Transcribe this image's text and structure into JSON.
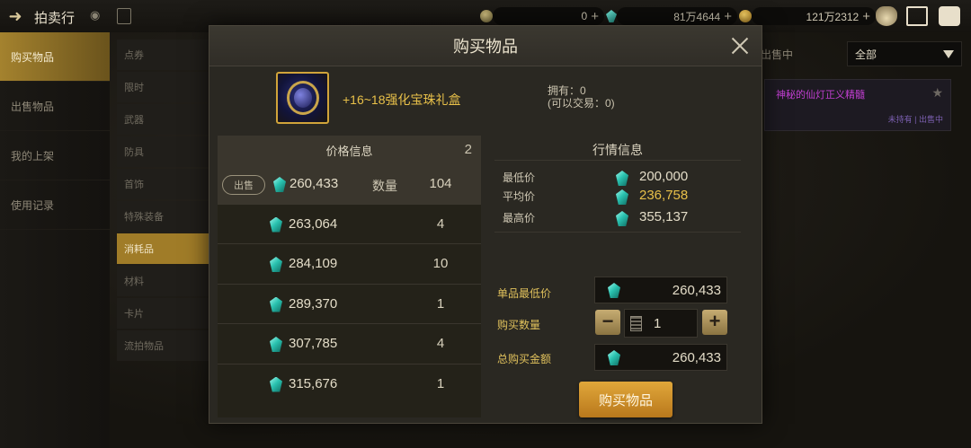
{
  "topbar": {
    "title": "拍卖行",
    "currencies": [
      {
        "icon": "moon-coin-icon",
        "value": "0"
      },
      {
        "icon": "gem-icon",
        "value": "81万4644"
      },
      {
        "icon": "gold-coin-icon",
        "value": "121万2312"
      }
    ]
  },
  "nav": {
    "items": [
      "购买物品",
      "出售物品",
      "我的上架",
      "使用记录"
    ],
    "active": 0
  },
  "categories": {
    "items": [
      "点券",
      "限时",
      "武器",
      "防具",
      "首饰",
      "特殊装备",
      "消耗品",
      "材料",
      "卡片",
      "流拍物品"
    ],
    "active": 6
  },
  "right_panel": {
    "label": "出售中",
    "filter": "全部",
    "listing": {
      "name": "神秘的仙灯正义精髓",
      "meta": "未持有 | 出售中"
    }
  },
  "modal": {
    "title": "购买物品",
    "item_name": "+16~18强化宝珠礼盒",
    "own_line1": "拥有：0",
    "own_line2": "(可以交易：0)",
    "price_table": {
      "header": "价格信息",
      "count": "2",
      "sell_tag": "出售",
      "qty_label": "数量",
      "rows": [
        {
          "price": "260,433",
          "qty": "104"
        },
        {
          "price": "263,064",
          "qty": "4"
        },
        {
          "price": "284,109",
          "qty": "10"
        },
        {
          "price": "289,370",
          "qty": "1"
        },
        {
          "price": "307,785",
          "qty": "4"
        },
        {
          "price": "315,676",
          "qty": "1"
        }
      ]
    },
    "market": {
      "header": "行情信息",
      "rows": [
        {
          "label": "最低价",
          "value": "200,000"
        },
        {
          "label": "平均价",
          "value": "236,758"
        },
        {
          "label": "最高价",
          "value": "355,137"
        }
      ]
    },
    "form": {
      "unit_label": "单品最低价",
      "unit_value": "260,433",
      "qty_label": "购买数量",
      "qty_value": "1",
      "total_label": "总购买金额",
      "total_value": "260,433",
      "buy_label": "购买物品"
    }
  }
}
